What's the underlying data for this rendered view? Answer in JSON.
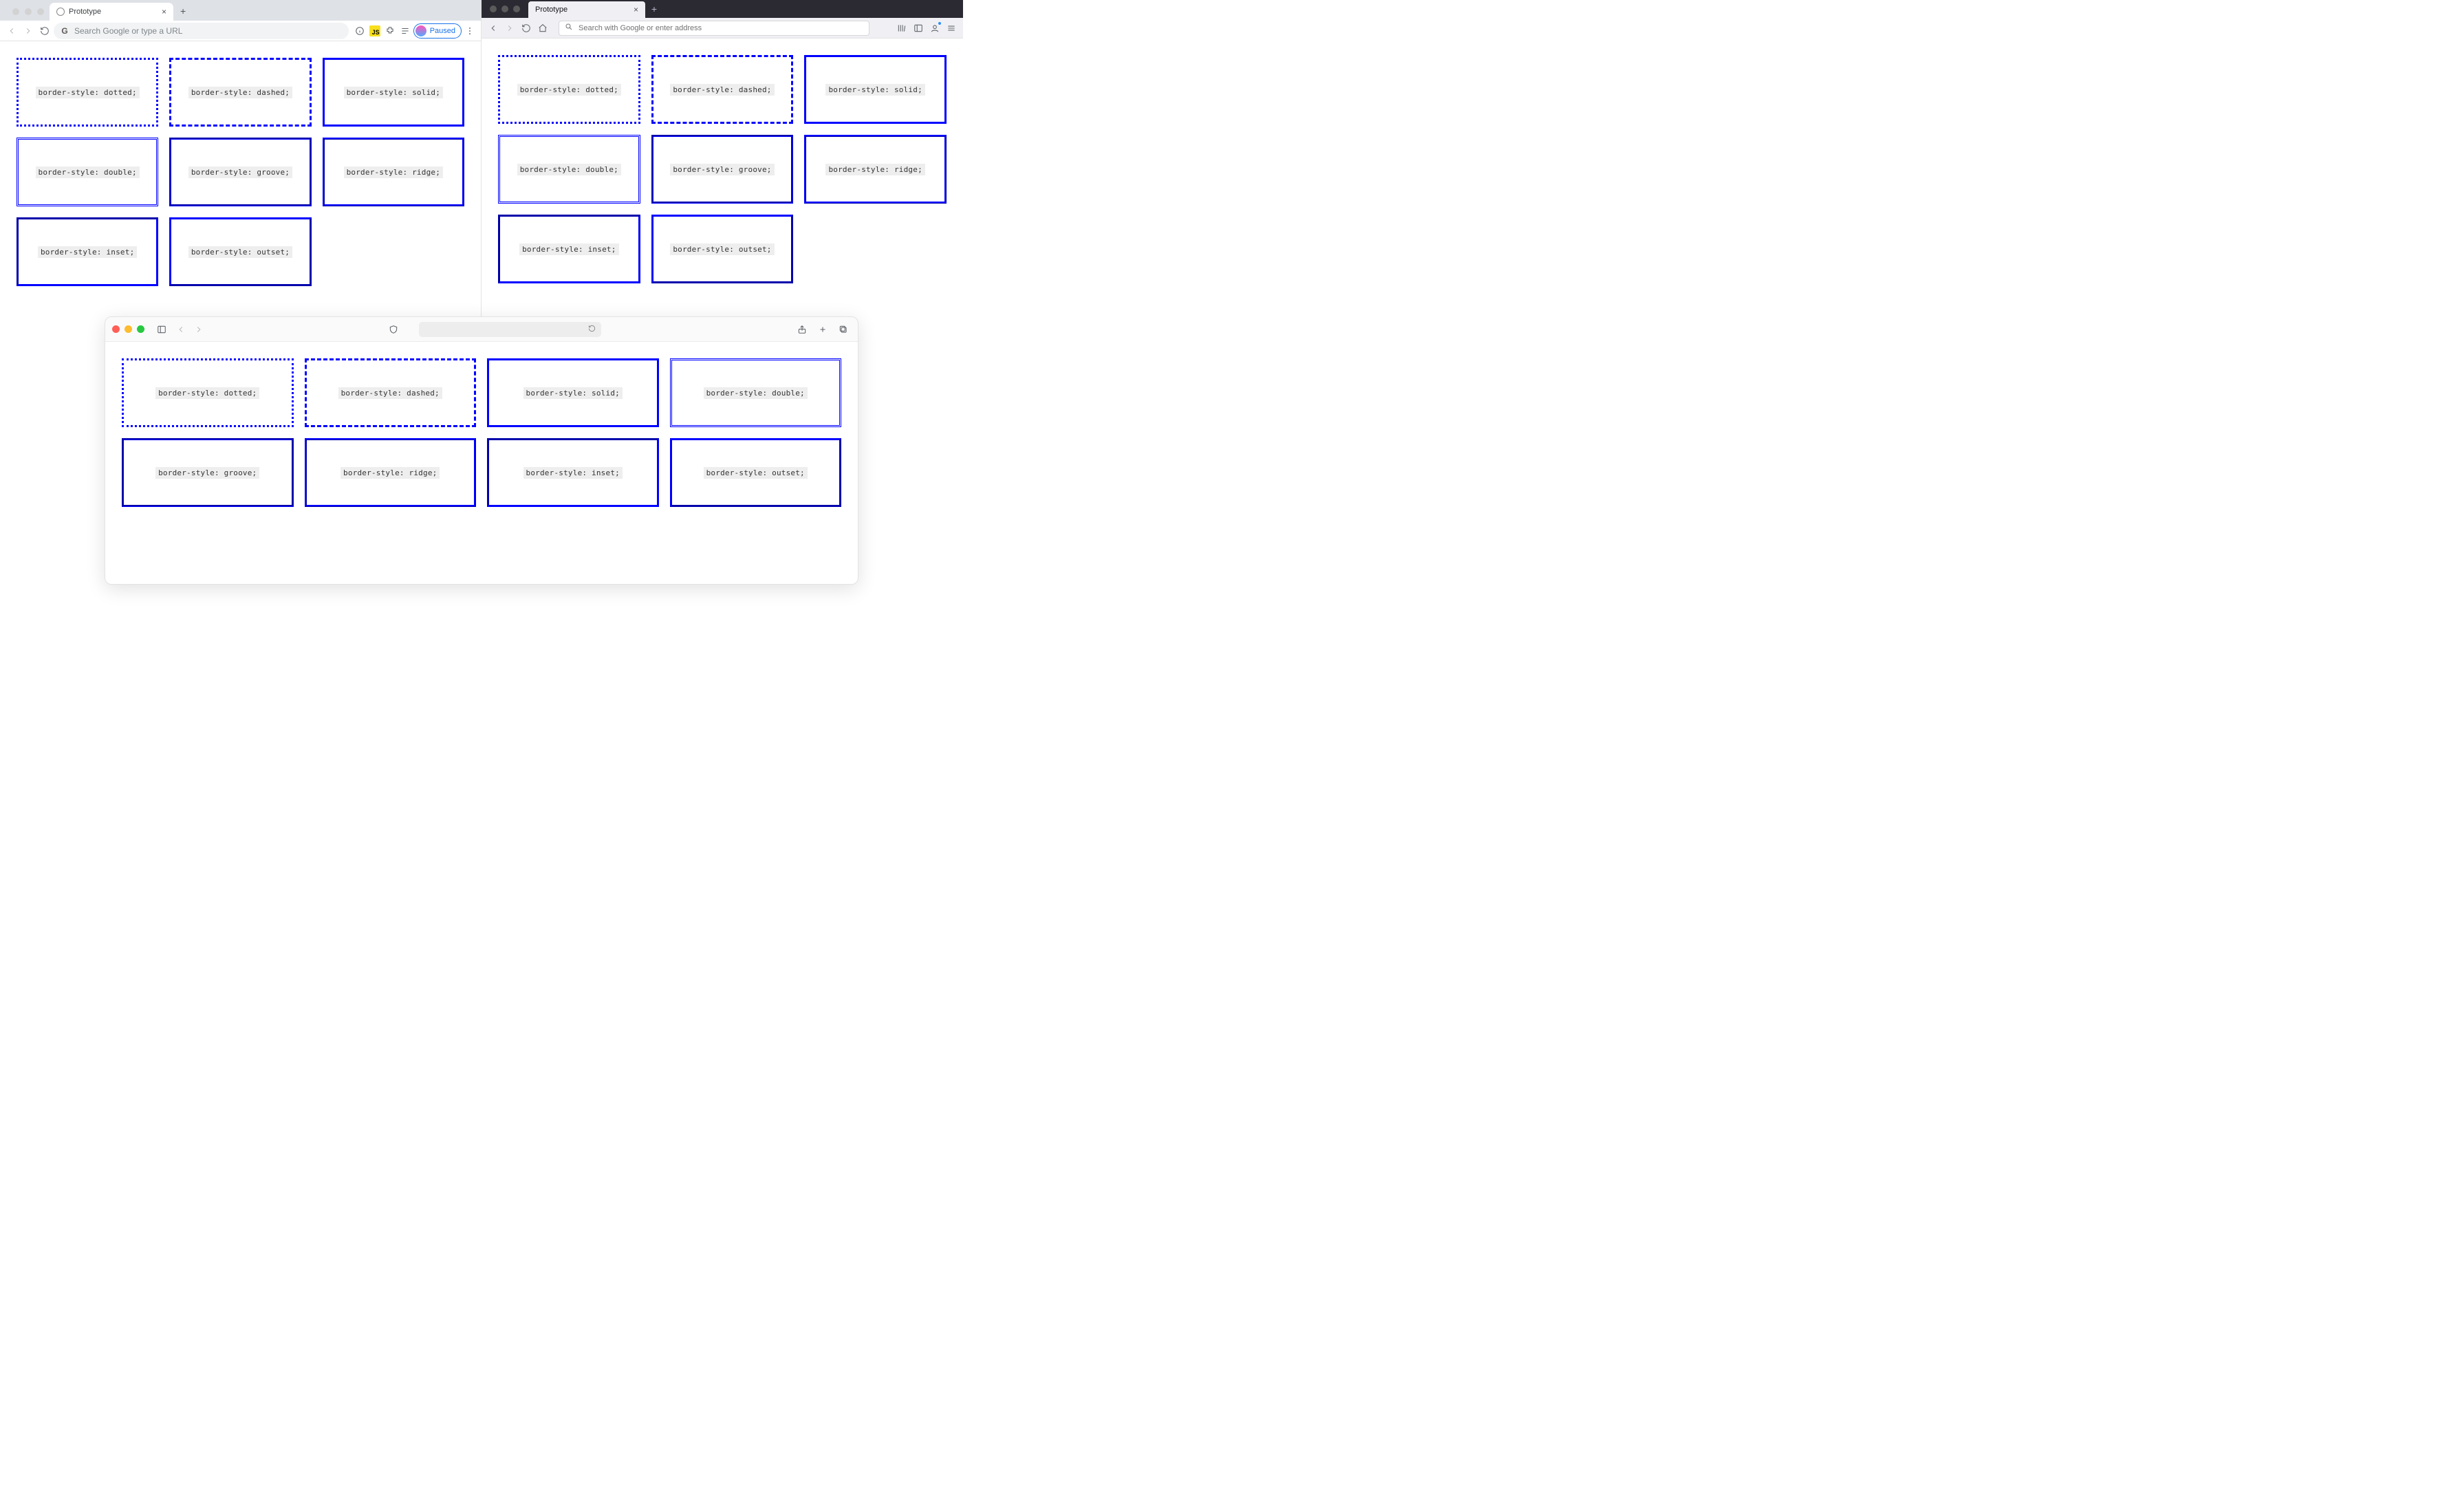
{
  "chrome": {
    "tab_title": "Prototype",
    "omnibox_placeholder": "Search Google or type a URL",
    "paused_label": "Paused"
  },
  "firefox": {
    "tab_title": "Prototype",
    "urlbar_placeholder": "Search with Google or enter address"
  },
  "safari": {},
  "boxes": {
    "dotted": "border-style: dotted;",
    "dashed": "border-style: dashed;",
    "solid": "border-style: solid;",
    "double": "border-style: double;",
    "groove": "border-style: groove;",
    "ridge": "border-style: ridge;",
    "inset": "border-style: inset;",
    "outset": "border-style: outset;"
  }
}
